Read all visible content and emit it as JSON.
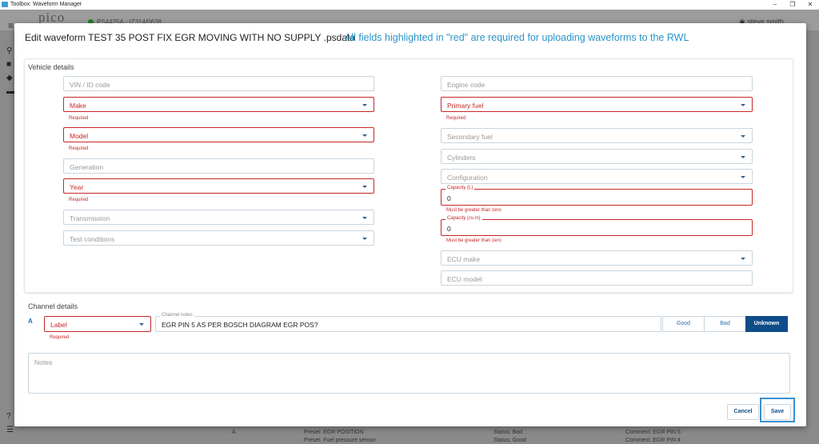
{
  "window": {
    "title": "Toolbox: Waveform Manager",
    "min": "–",
    "restore": "❐",
    "close": "✕"
  },
  "background": {
    "logo": "pico",
    "device": "PS4425A - IZ314/0638",
    "user": "steve smith",
    "bottom": {
      "col1": "A",
      "preset1": "Preset: EGR POSITION",
      "preset2": "Preset: Fuel pressure sensor",
      "status1": "Status: Bad",
      "status2": "Status: Good",
      "comment1": "Comment: EGR PIN 5",
      "comment2": "Comment: EGR PIN 4"
    }
  },
  "modal": {
    "title": "Edit waveform TEST 35 POST FIX EGR MOVING WITH NO SUPPLY .psdata",
    "requirement_note": "All fields highlighted in \"red\" are required for uploading waveforms to the RWL",
    "vehicle_details": {
      "section_title": "Vehicle details",
      "vin": "VIN / ID code",
      "make": "Make",
      "make_helper": "Required",
      "model": "Model",
      "model_helper": "Required",
      "generation": "Generation",
      "year": "Year",
      "year_helper": "Required",
      "transmission": "Transmission",
      "test_conditions": "Test conditions",
      "engine_code": "Engine code",
      "primary_fuel": "Primary fuel",
      "primary_fuel_helper": "Required",
      "secondary_fuel": "Secondary fuel",
      "cylinders": "Cylinders",
      "configuration": "Configuration",
      "capacity_l_label": "Capacity (L)",
      "capacity_l_value": "0",
      "capacity_l_helper": "Must be greater than zero",
      "capacity_cu_label": "Capacity (cu in)",
      "capacity_cu_value": "0",
      "capacity_cu_helper": "Must be greater than zero",
      "ecu_make": "ECU make",
      "ecu_model": "ECU model"
    },
    "channel_details": {
      "section_title": "Channel details",
      "channel": "A",
      "label": "Label",
      "label_helper": "Required",
      "notes_label": "Channel notes",
      "notes_value": "EGR PIN 5 AS PER BOSCH DIAGRAM EGR POS?",
      "good": "Good",
      "bad": "Bad",
      "unknown": "Unknown"
    },
    "notes_placeholder": "Notes",
    "cancel": "Cancel",
    "save": "Save"
  }
}
